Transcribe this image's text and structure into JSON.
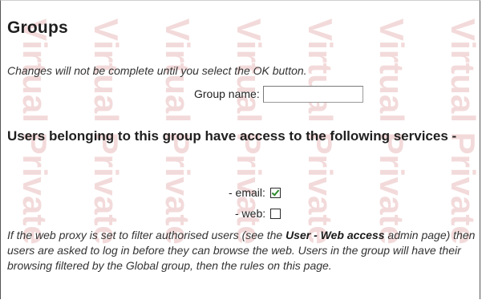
{
  "page": {
    "title": "Groups",
    "notice": "Changes will not be complete until you select the OK button.",
    "watermark_text": "Virtual Private"
  },
  "group_form": {
    "name_label": "Group name:",
    "name_value": "",
    "name_placeholder": ""
  },
  "services": {
    "heading": "Users belonging to this group have access to the following services -",
    "items": [
      {
        "label": "- email:",
        "checked": true
      },
      {
        "label": "- web:",
        "checked": false
      }
    ]
  },
  "help": {
    "text_before": "If the web proxy is set to filter authorised users (see the ",
    "link_text": "User - Web access",
    "text_after": " admin page) then users are asked to log in before they can browse the web. Users in the group will have their browsing filtered by the Global group, then the rules on this page."
  },
  "colors": {
    "text": "#1a1a1a",
    "watermark": "#f3dada",
    "check": "#2e8b2e",
    "border": "#555555"
  }
}
